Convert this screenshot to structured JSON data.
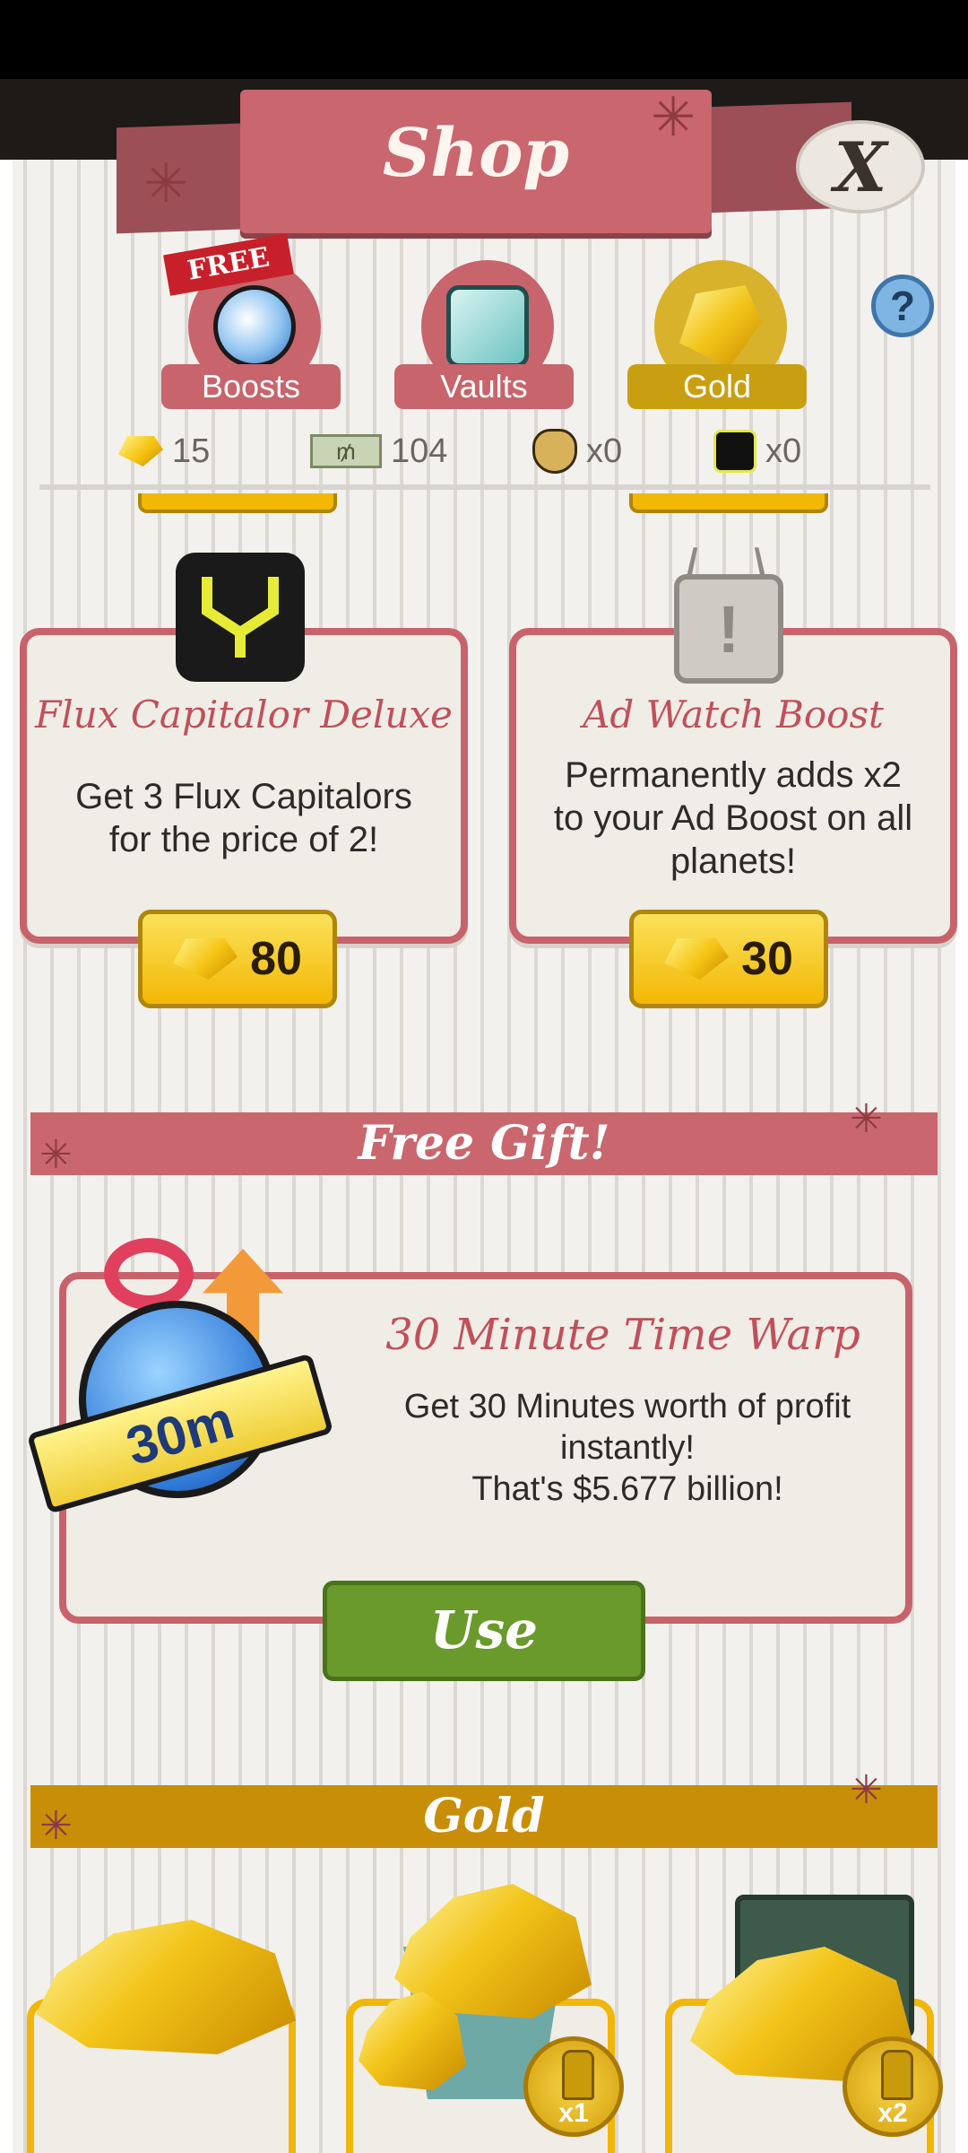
{
  "header": {
    "title": "Shop",
    "close_label": "X",
    "help_label": "?"
  },
  "tabs": [
    {
      "label": "Boosts",
      "badge": "FREE",
      "icon": "stopwatch-icon"
    },
    {
      "label": "Vaults",
      "icon": "vault-icon"
    },
    {
      "label": "Gold",
      "icon": "gold-icon",
      "selected": true
    }
  ],
  "currencies": {
    "gold": "15",
    "megabucks": "104",
    "megabucks_symbol": "₥",
    "cash_boost": "x0",
    "flux": "x0"
  },
  "cards": [
    {
      "title": "Flux Capitalor Deluxe",
      "description_lines": [
        "Get 3 Flux Capitalors",
        "for the price of 2!"
      ],
      "price": "80",
      "icon": "flux-capacitor-icon"
    },
    {
      "title": "Ad Watch Boost",
      "description_lines": [
        "Permanently adds x2",
        "to your Ad Boost on all",
        "planets!"
      ],
      "price": "30",
      "icon": "tv-icon"
    }
  ],
  "free_gift": {
    "section_title": "Free Gift!",
    "title": "30 Minute Time Warp",
    "description_lines": [
      "Get 30 Minutes worth of profit",
      "instantly!",
      "That's $5.677 billion!"
    ],
    "badge": "30m",
    "button_label": "Use"
  },
  "gold_section": {
    "title": "Gold",
    "badges": [
      "x1",
      "x2"
    ]
  },
  "colors": {
    "accent_pink": "#c9666e",
    "gold": "#f2b805",
    "green": "#6a9a2b"
  }
}
